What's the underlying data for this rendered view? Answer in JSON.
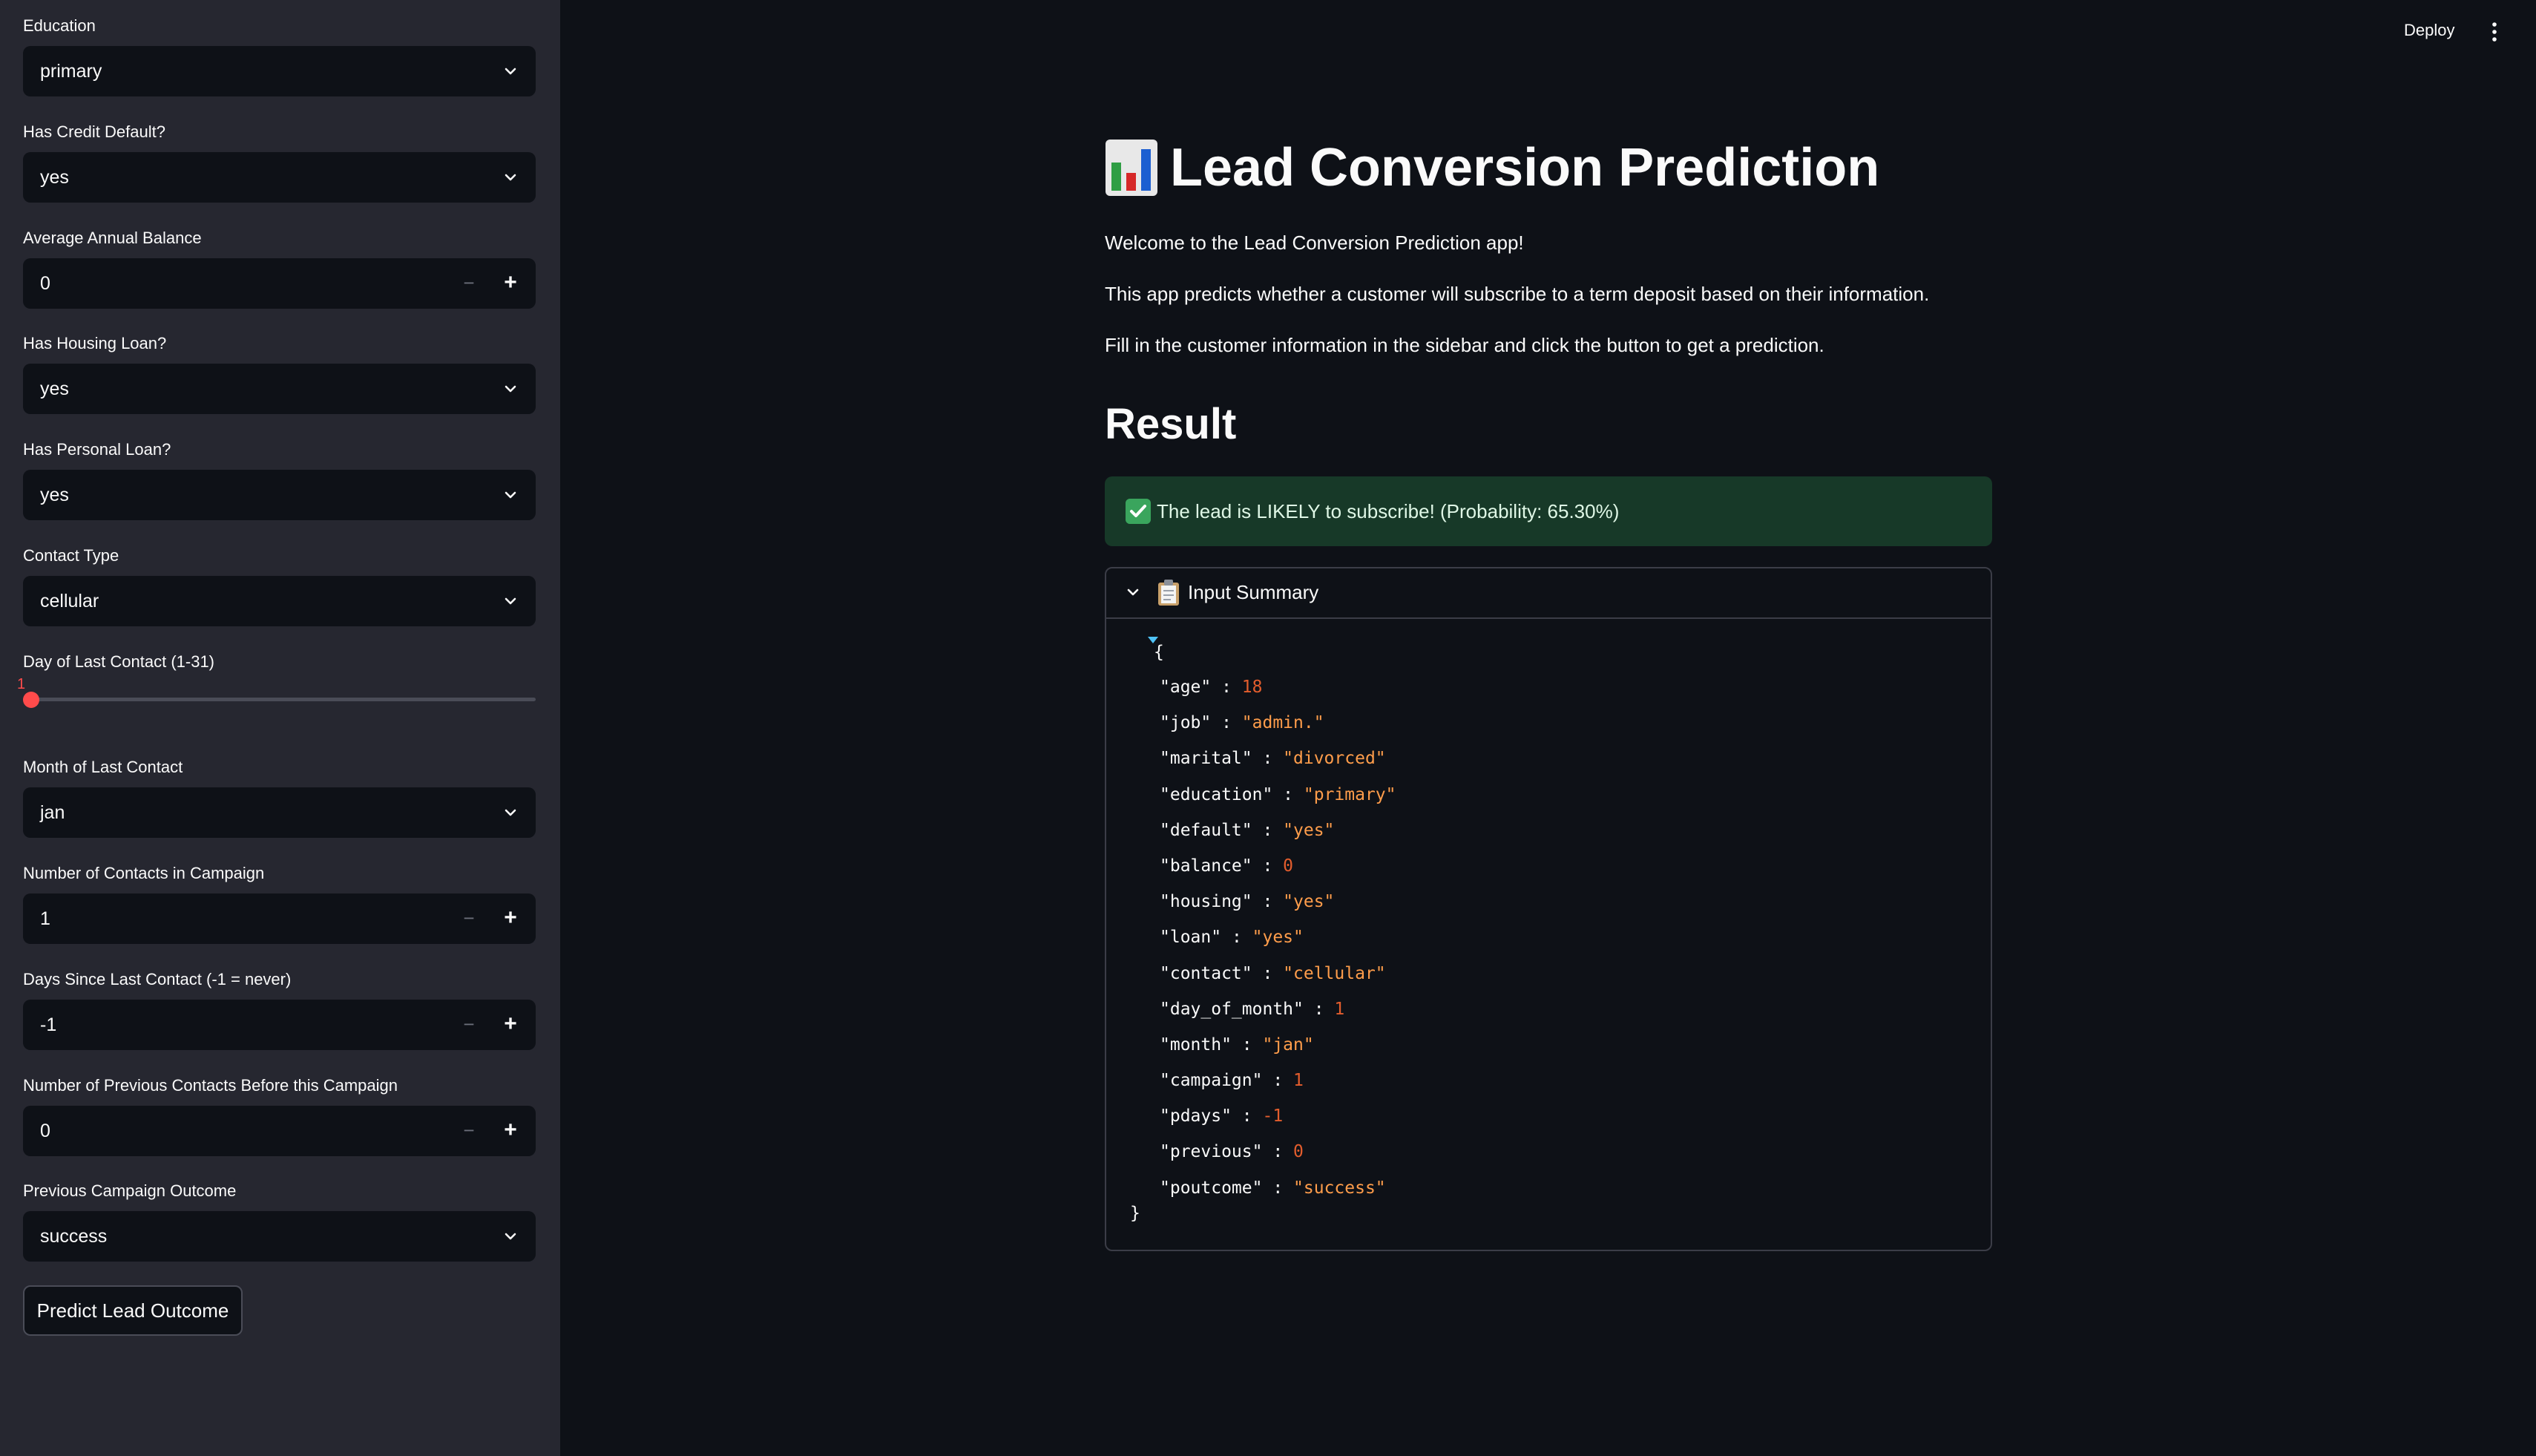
{
  "topbar": {
    "deploy_label": "Deploy"
  },
  "sidebar": {
    "education": {
      "label": "Education",
      "value": "primary"
    },
    "default": {
      "label": "Has Credit Default?",
      "value": "yes"
    },
    "balance": {
      "label": "Average Annual Balance",
      "value": "0",
      "minus": "−",
      "plus": "+"
    },
    "housing": {
      "label": "Has Housing Loan?",
      "value": "yes"
    },
    "loan": {
      "label": "Has Personal Loan?",
      "value": "yes"
    },
    "contact": {
      "label": "Contact Type",
      "value": "cellular"
    },
    "day": {
      "label": "Day of Last Contact (1-31)",
      "value": "1",
      "min": 1,
      "max": 31,
      "fraction": 0
    },
    "month": {
      "label": "Month of Last Contact",
      "value": "jan"
    },
    "campaign": {
      "label": "Number of Contacts in Campaign",
      "value": "1",
      "minus": "−",
      "plus": "+"
    },
    "pdays": {
      "label": "Days Since Last Contact (-1 = never)",
      "value": "-1",
      "minus": "−",
      "plus": "+"
    },
    "previous": {
      "label": "Number of Previous Contacts Before this Campaign",
      "value": "0",
      "minus": "−",
      "plus": "+"
    },
    "poutcome": {
      "label": "Previous Campaign Outcome",
      "value": "success"
    },
    "predict_button": "Predict Lead Outcome"
  },
  "main": {
    "title": "Lead Conversion Prediction",
    "intro": [
      "Welcome to the Lead Conversion Prediction app!",
      "This app predicts whether a customer will subscribe to a term deposit based on their information.",
      "Fill in the customer information in the sidebar and click the button to get a prediction."
    ],
    "result_heading": "Result",
    "result_message": "The lead is LIKELY to subscribe! (Probability: 65.30%)",
    "summary": {
      "label": "Input Summary",
      "open_brace": "{",
      "close_brace": "}",
      "entries": [
        {
          "key": "\"age\"",
          "value": "18",
          "kind": "num"
        },
        {
          "key": "\"job\"",
          "value": "\"admin.\"",
          "kind": "str"
        },
        {
          "key": "\"marital\"",
          "value": "\"divorced\"",
          "kind": "str"
        },
        {
          "key": "\"education\"",
          "value": "\"primary\"",
          "kind": "str"
        },
        {
          "key": "\"default\"",
          "value": "\"yes\"",
          "kind": "str"
        },
        {
          "key": "\"balance\"",
          "value": "0",
          "kind": "num"
        },
        {
          "key": "\"housing\"",
          "value": "\"yes\"",
          "kind": "str"
        },
        {
          "key": "\"loan\"",
          "value": "\"yes\"",
          "kind": "str"
        },
        {
          "key": "\"contact\"",
          "value": "\"cellular\"",
          "kind": "str"
        },
        {
          "key": "\"day_of_month\"",
          "value": "1",
          "kind": "num"
        },
        {
          "key": "\"month\"",
          "value": "\"jan\"",
          "kind": "str"
        },
        {
          "key": "\"campaign\"",
          "value": "1",
          "kind": "num"
        },
        {
          "key": "\"pdays\"",
          "value": "-1",
          "kind": "num"
        },
        {
          "key": "\"previous\"",
          "value": "0",
          "kind": "num"
        },
        {
          "key": "\"poutcome\"",
          "value": "\"success\"",
          "kind": "str"
        }
      ]
    }
  },
  "colors": {
    "accent": "#ff4b4b",
    "success_bg": "#173928",
    "json_string": "#ff9d4b",
    "json_number": "#e35d2d",
    "sidebar_bg": "#262730",
    "main_bg": "#0e1117"
  }
}
